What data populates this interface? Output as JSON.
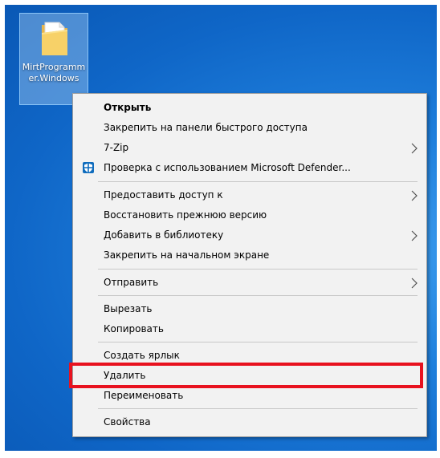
{
  "desktop_icon": {
    "label": "MirtProgrammer.Windows",
    "icon": "folder-icon"
  },
  "context_menu": {
    "items": [
      {
        "label": "Открыть",
        "bold": true
      },
      {
        "label": "Закрепить на панели быстрого доступа"
      },
      {
        "label": "7-Zip",
        "submenu": true
      },
      {
        "label": "Проверка с использованием Microsoft Defender...",
        "icon": "defender-shield-icon"
      },
      {
        "label": "Предоставить доступ к",
        "submenu": true
      },
      {
        "label": "Восстановить прежнюю версию"
      },
      {
        "label": "Добавить в библиотеку",
        "submenu": true
      },
      {
        "label": "Закрепить на начальном экране"
      },
      {
        "label": "Отправить",
        "submenu": true
      },
      {
        "label": "Вырезать"
      },
      {
        "label": "Копировать"
      },
      {
        "label": "Создать ярлык"
      },
      {
        "label": "Удалить",
        "highlighted": true
      },
      {
        "label": "Переименовать"
      },
      {
        "label": "Свойства"
      }
    ]
  },
  "colors": {
    "menu_bg": "#f2f2f2",
    "highlight_border": "#e8121f",
    "desktop_blue": "#1f7fdc",
    "defender_blue": "#0f6cbd"
  }
}
